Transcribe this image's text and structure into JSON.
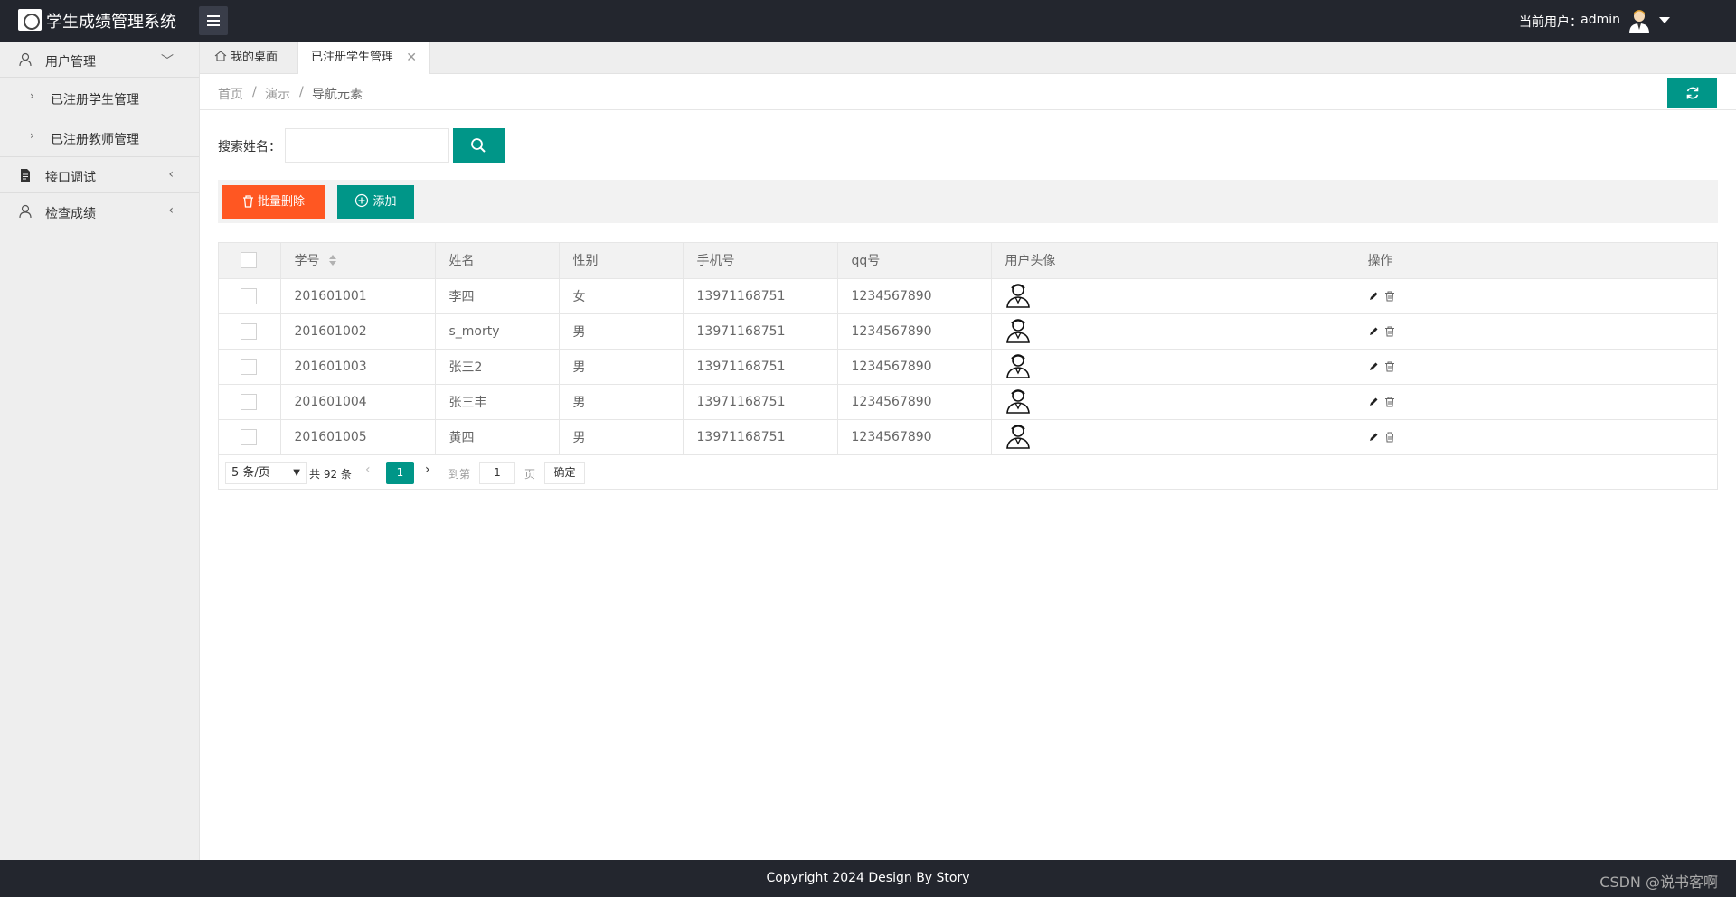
{
  "header": {
    "app_title": "学生成绩管理系统",
    "current_user_label": "当前用户：",
    "current_user_name": "admin"
  },
  "sidebar": {
    "groups": [
      {
        "label": "用户管理",
        "icon": "user-icon",
        "expanded": true,
        "items": [
          {
            "label": "已注册学生管理"
          },
          {
            "label": "已注册教师管理"
          }
        ]
      },
      {
        "label": "接口调试",
        "icon": "document-icon",
        "expanded": false
      },
      {
        "label": "检查成绩",
        "icon": "user-icon",
        "expanded": false
      }
    ]
  },
  "tabs": [
    {
      "label": "我的桌面",
      "icon": "home-icon"
    },
    {
      "label": "已注册学生管理",
      "active": true
    }
  ],
  "breadcrumb": [
    "首页",
    "演示",
    "导航元素"
  ],
  "search": {
    "label": "搜索姓名：",
    "value": ""
  },
  "toolbar": {
    "batch_delete": "批量删除",
    "add": "添加"
  },
  "table": {
    "columns": [
      "学号",
      "姓名",
      "性别",
      "手机号",
      "qq号",
      "用户头像",
      "操作"
    ],
    "rows": [
      {
        "id": "201601001",
        "name": "李四",
        "gender": "女",
        "phone": "13971168751",
        "qq": "1234567890"
      },
      {
        "id": "201601002",
        "name": "s_morty",
        "gender": "男",
        "phone": "13971168751",
        "qq": "1234567890"
      },
      {
        "id": "201601003",
        "name": "张三2",
        "gender": "男",
        "phone": "13971168751",
        "qq": "1234567890"
      },
      {
        "id": "201601004",
        "name": "张三丰",
        "gender": "男",
        "phone": "13971168751",
        "qq": "1234567890"
      },
      {
        "id": "201601005",
        "name": "黄四",
        "gender": "男",
        "phone": "13971168751",
        "qq": "1234567890"
      }
    ]
  },
  "pager": {
    "limit": "5 条/页",
    "total": "共 92 条",
    "current_page": "1",
    "goto_label": "到第",
    "goto_value": "1",
    "page_unit": "页",
    "confirm": "确定"
  },
  "footer": {
    "copyright": "Copyright 2024 Design By Story",
    "watermark": "CSDN @说书客啊"
  },
  "colors": {
    "primary": "#009688",
    "danger": "#ff5722",
    "header_bg": "#23262e"
  }
}
